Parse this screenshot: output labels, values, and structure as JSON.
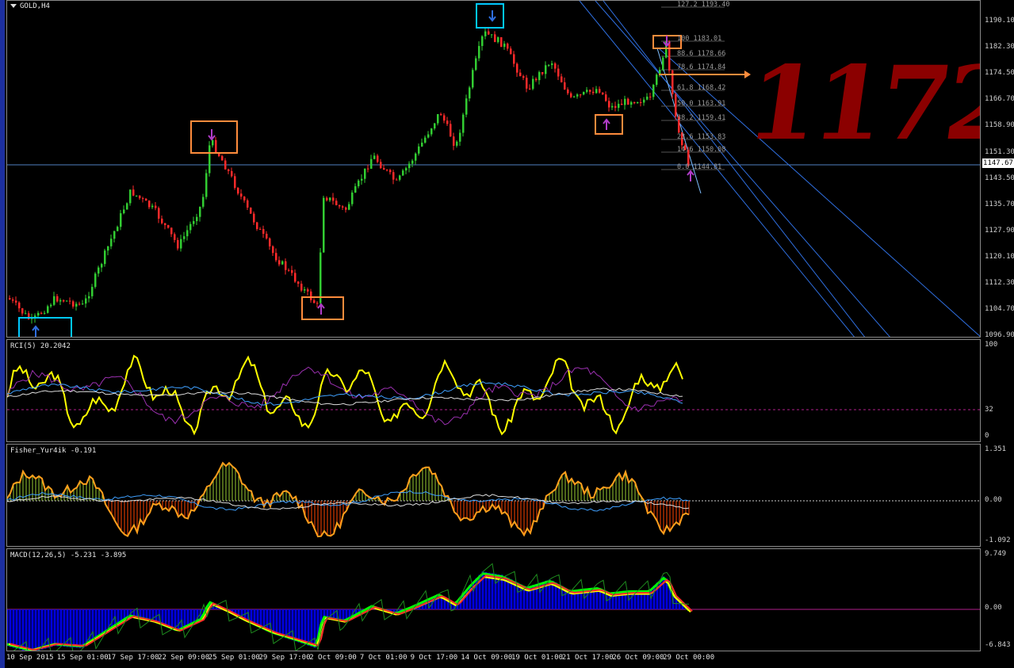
{
  "window": {
    "symbol_title": "GOLD,H4"
  },
  "price_pane": {
    "scale": [
      "1190.10",
      "1182.30",
      "1174.50",
      "1166.70",
      "1158.90",
      "1151.30",
      "1143.50",
      "1135.70",
      "1127.90",
      "1120.10",
      "1112.30",
      "1104.70",
      "1096.90"
    ],
    "current_price": "1147.67",
    "annotation": "1172",
    "fib_levels": [
      {
        "ratio": "127.2",
        "price": "1193.40"
      },
      {
        "ratio": "100",
        "price": "1183.01"
      },
      {
        "ratio": "88.6",
        "price": "1178.66"
      },
      {
        "ratio": "78.6",
        "price": "1174.84"
      },
      {
        "ratio": "61.8",
        "price": "1168.42"
      },
      {
        "ratio": "50.0",
        "price": "1163.91"
      },
      {
        "ratio": "38.2",
        "price": "1159.41"
      },
      {
        "ratio": "23.6",
        "price": "1153.83"
      },
      {
        "ratio": "14.6",
        "price": "1150.08"
      },
      {
        "ratio": "0.0",
        "price": "1144.81"
      }
    ],
    "colors": {
      "bull": "#32cd32",
      "bear": "#ff2a2a",
      "box_cyan": "#00c8ff",
      "box_orange": "#ff8c3c",
      "annotation": "#8b0000",
      "channel": "#2f6fe0"
    }
  },
  "rci_pane": {
    "label": "RCI(5) 20.2042",
    "scale": [
      "100",
      "32",
      "0"
    ]
  },
  "fisher_pane": {
    "label": "Fisher_Yur4ik -0.191",
    "scale": [
      "1.351",
      "0.00",
      "-1.092"
    ]
  },
  "macd_pane": {
    "label": "MACD(12,26,5) -5.231 -3.895",
    "scale": [
      "9.749",
      "0.00",
      "-6.843"
    ]
  },
  "time_axis": [
    "10 Sep 2015",
    "15 Sep 01:00",
    "17 Sep 17:00",
    "22 Sep 09:00",
    "25 Sep 01:00",
    "29 Sep 17:00",
    "2 Oct 09:00",
    "7 Oct 01:00",
    "9 Oct 17:00",
    "14 Oct 09:00",
    "19 Oct 01:00",
    "21 Oct 17:00",
    "26 Oct 09:00",
    "29 Oct 00:00"
  ]
}
